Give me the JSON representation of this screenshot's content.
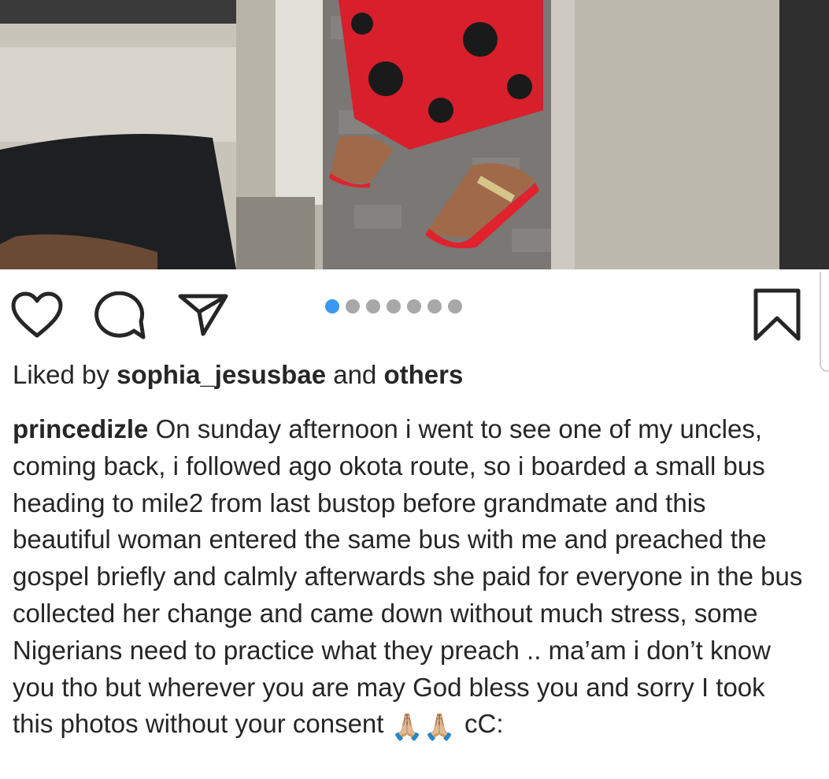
{
  "post": {
    "photo_alt": "photo",
    "carousel": {
      "count": 7,
      "active_index": 0
    },
    "colors": {
      "accent": "#3897f0",
      "dot_inactive": "#a8a8a8",
      "text": "#262626"
    }
  },
  "actions": {
    "like": "heart-icon",
    "comment": "comment-icon",
    "share": "share-icon",
    "save": "bookmark-icon"
  },
  "likes": {
    "prefix": "Liked by",
    "user": "sophia_jesusbae",
    "middle": "and",
    "others": "others"
  },
  "caption": {
    "username": "princedizle",
    "text": "On sunday afternoon i went to see one of my uncles, coming back, i followed ago okota route, so i boarded a small bus heading to mile2 from last bustop before grandmate and this beautiful woman entered the same bus with me and preached the gospel briefly and calmly afterwards she paid for everyone in the bus collected her change and came down without much stress, some Nigerians need to practice what they preach .. ma’am i don’t know you tho but wherever you are may God bless you and sorry I took this photos without your consent",
    "emoji": "🙏🏼🙏🏼",
    "tail": "cC:"
  }
}
